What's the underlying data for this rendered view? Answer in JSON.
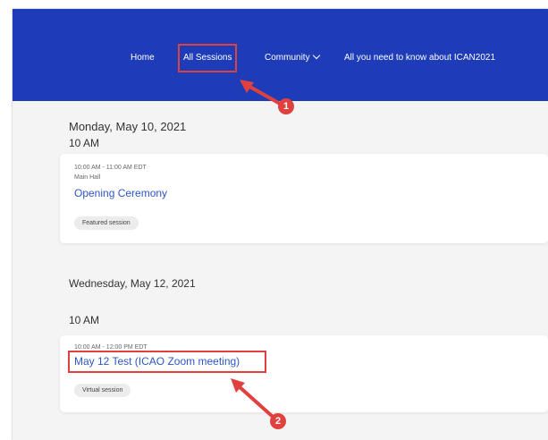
{
  "nav": {
    "home": "Home",
    "all_sessions": "All Sessions",
    "community": "Community",
    "about": "All you need to know about ICAN2021"
  },
  "day1": {
    "date": "Monday, May 10, 2021",
    "time": "10 AM",
    "session": {
      "time": "10:00 AM - 11:00 AM EDT",
      "location": "Main Hall",
      "title": "Opening Ceremony",
      "tag": "Featured session"
    }
  },
  "day2": {
    "date": "Wednesday, May 12, 2021",
    "time": "10 AM",
    "session": {
      "time": "10:00 AM - 12:00 PM EDT",
      "title": "May 12 Test (ICAO Zoom meeting)",
      "tag": "Virtual session"
    }
  },
  "callouts": {
    "step1": "1",
    "step2": "2"
  },
  "colors": {
    "nav_bg": "#1f3cb8",
    "annotation_red": "#e0413f",
    "link_blue": "#2e56c6"
  },
  "icons": {
    "community_dropdown": "chevron-down-icon"
  }
}
